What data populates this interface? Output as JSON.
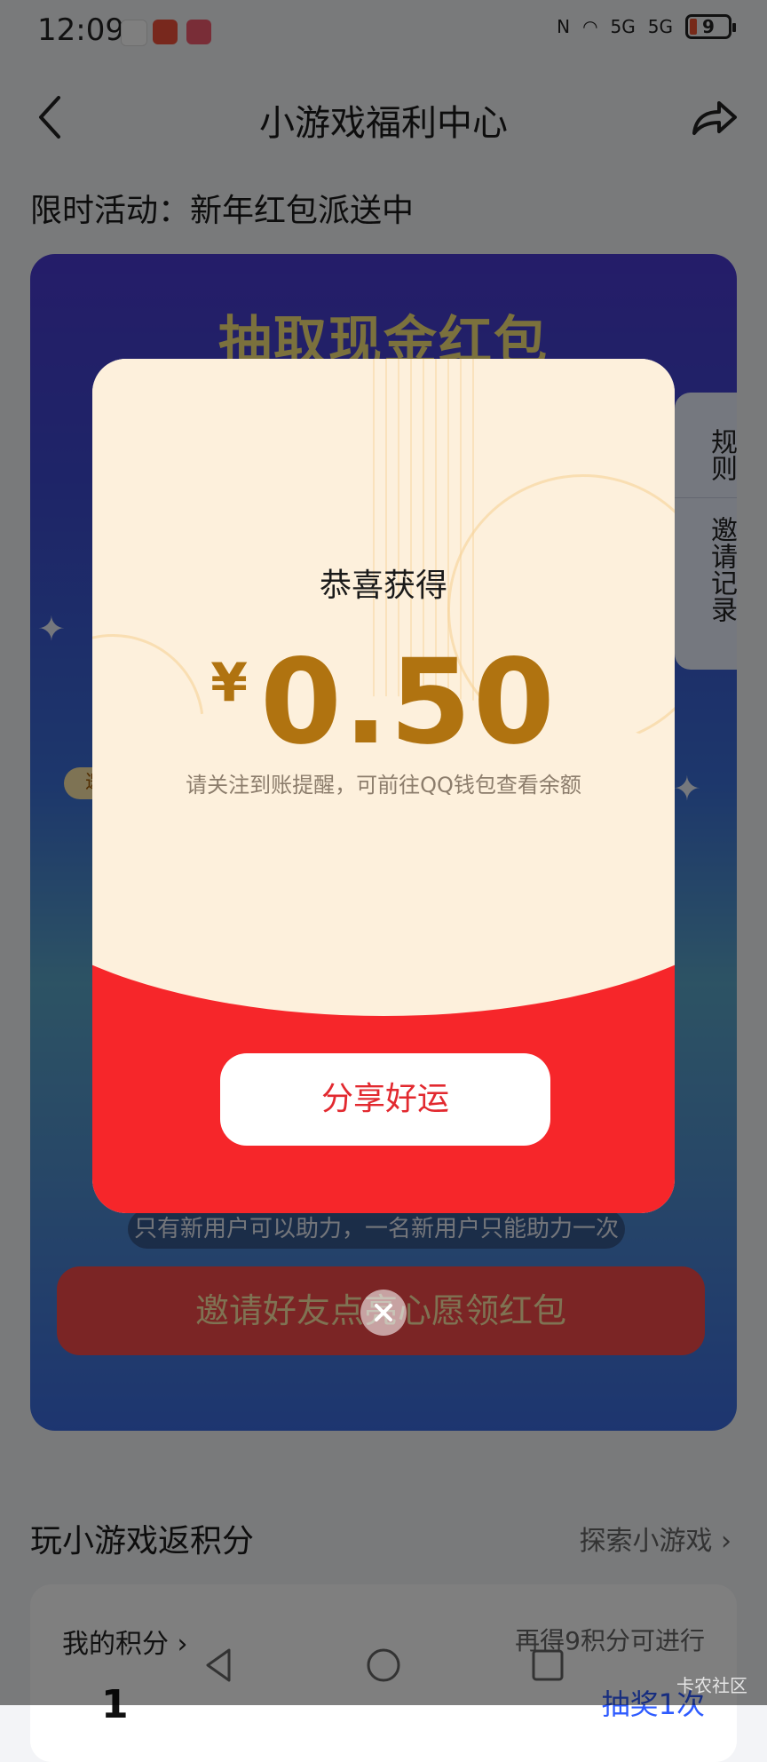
{
  "status_bar": {
    "time": "12:09",
    "signal_1": "5G",
    "signal_2": "5G",
    "battery": "9"
  },
  "header": {
    "title": "小游戏福利中心"
  },
  "subtitle": "限时活动：新年红包派送中",
  "banner": {
    "title": "抽取现金红包",
    "side_tabs": [
      "规则",
      "邀请记录"
    ],
    "badge": "邀",
    "tip": "只有新用户可以助力，一名新用户只能助力一次",
    "button": "邀请好友点亮心愿领红包"
  },
  "section": {
    "title": "玩小游戏返积分",
    "link": "探索小游戏 ›",
    "points_label": "我的积分 ›",
    "points_hint": "再得9积分可进行",
    "points_value": "1",
    "points_action": "抽奖1次"
  },
  "modal": {
    "congrats": "恭喜获得",
    "currency": "¥",
    "amount": "0.50",
    "hint": "请关注到账提醒，可前往QQ钱包查看余额",
    "share_button": "分享好运"
  },
  "watermark": "卡农社区",
  "colors": {
    "modal_red": "#f6262a",
    "modal_cream": "#fdf0dc",
    "amount_gold": "#b07310"
  }
}
